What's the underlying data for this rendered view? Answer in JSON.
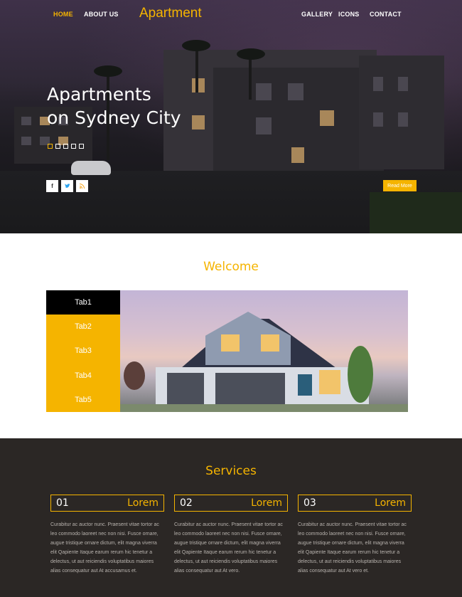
{
  "nav": {
    "left": [
      "HOME",
      "ABOUT US"
    ],
    "brand": "Apartment",
    "right": [
      "GALLERY",
      "ICONS",
      "CONTACT"
    ]
  },
  "hero": {
    "title_line1": "Apartments",
    "title_line2": "on Sydney City",
    "social": [
      "f",
      "t",
      "rss"
    ],
    "read_more": "Read More"
  },
  "welcome": {
    "title": "Welcome",
    "tabs": [
      "Tab1",
      "Tab2",
      "Tab3",
      "Tab4",
      "Tab5"
    ],
    "active_tab": "Tab1"
  },
  "services": {
    "title": "Services",
    "cards": [
      {
        "num": "01",
        "label": "Lorem",
        "text": "Curabitur ac auctor nunc. Praesent vitae tortor ac leo commodo laoreet nec non nisi. Fusce ornare, augue tristique ornare dictum, elit magna viverra elit Qapiente Itaque earum rerum hic tenetur a delectus, ut aut reiciendis voluptatibus maiores alias consequatur aut At accusamus et."
      },
      {
        "num": "02",
        "label": "Lorem",
        "text": "Curabitur ac auctor nunc. Praesent vitae tortor ac leo commodo laoreet nec non nisi. Fusce ornare, augue tristique ornare dictum, elit magna viverra elit Qapiente Itaque earum rerum hic tenetur a delectus, ut aut reiciendis voluptatibus maiores alias consequatur aut At vero."
      },
      {
        "num": "03",
        "label": "Lorem",
        "text": "Curabitur ac auctor nunc. Praesent vitae tortor ac leo commodo laoreet nec non nisi. Fusce ornare, augue tristique ornare dictum, elit magna viverra elit Qapiente Itaque earum rerum hic tenetur a delectus, ut aut reiciendis voluptatibus maiores alias consequatur aut At vero et."
      }
    ]
  },
  "colors": {
    "accent": "#f5b400",
    "services_bg": "#2b2725"
  }
}
